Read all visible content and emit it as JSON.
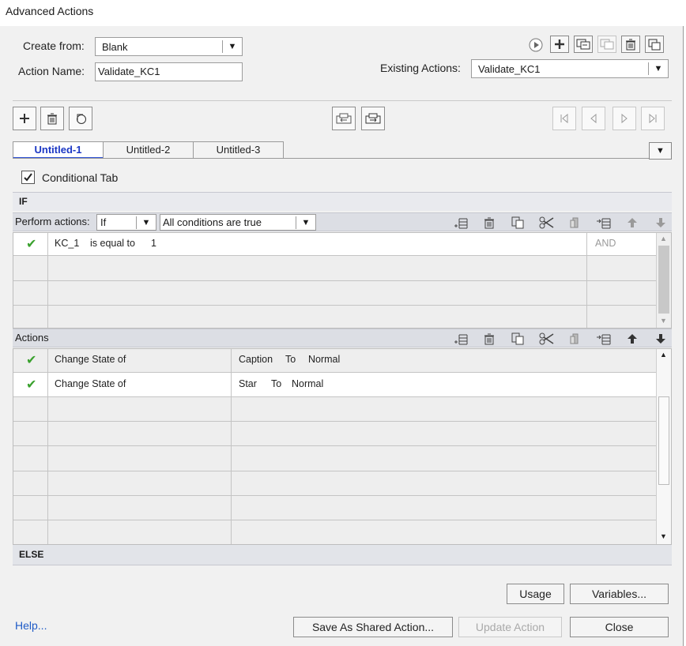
{
  "window": {
    "title": "Advanced Actions"
  },
  "form": {
    "create_from_label": "Create from:",
    "create_from_value": "Blank",
    "action_name_label": "Action Name:",
    "action_name_value": "Validate_KC1",
    "existing_actions_label": "Existing Actions:",
    "existing_actions_value": "Validate_KC1"
  },
  "tabs": [
    {
      "label": "Untitled-1",
      "active": true
    },
    {
      "label": "Untitled-2",
      "active": false
    },
    {
      "label": "Untitled-3",
      "active": false
    }
  ],
  "conditional_tab_label": "Conditional Tab",
  "if_section": {
    "header": "IF",
    "perform_label": "Perform actions:",
    "perform_value": "If",
    "conditions_value": "All conditions are true",
    "rows": [
      {
        "var": "KC_1",
        "op": "is equal to",
        "value": "1",
        "logic": "AND"
      }
    ]
  },
  "actions_section": {
    "header": "Actions",
    "rows": [
      {
        "action": "Change State of",
        "target": "Caption",
        "to": "To",
        "state": "Normal"
      },
      {
        "action": "Change State of",
        "target": "Star",
        "to": "To",
        "state": "Normal"
      }
    ]
  },
  "else_section": {
    "header": "ELSE"
  },
  "buttons": {
    "usage": "Usage",
    "variables": "Variables...",
    "help": "Help...",
    "save_shared": "Save As Shared Action...",
    "update": "Update Action",
    "close": "Close"
  },
  "colors": {
    "accent_blue": "#1b37c4",
    "check_green": "#3aa12e",
    "bar_bg": "#dcdee4"
  }
}
